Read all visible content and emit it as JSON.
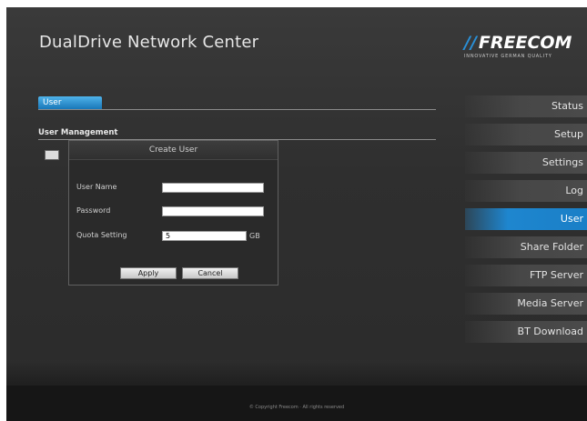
{
  "header": {
    "app_title": "DualDrive Network Center",
    "brand_name": "FREECOM",
    "brand_slashes": "//",
    "brand_tagline": "INNOVATIVE GERMAN QUALITY"
  },
  "main": {
    "active_tab": "User",
    "section_title": "User Management"
  },
  "dialog": {
    "title": "Create User",
    "fields": {
      "user_name_label": "User Name",
      "user_name_value": "",
      "password_label": "Password",
      "password_value": "",
      "quota_label": "Quota Setting",
      "quota_value": "5",
      "quota_unit": "GB"
    },
    "apply_label": "Apply",
    "cancel_label": "Cancel"
  },
  "sidebar": {
    "active": "User",
    "items": [
      {
        "label": "Status"
      },
      {
        "label": "Setup"
      },
      {
        "label": "Settings"
      },
      {
        "label": "Log"
      },
      {
        "label": "User"
      },
      {
        "label": "Share Folder"
      },
      {
        "label": "FTP Server"
      },
      {
        "label": "Media Server"
      },
      {
        "label": "BT Download"
      }
    ]
  },
  "footer": {
    "copyright": "© Copyright Freecom · All rights reserved"
  },
  "colors": {
    "accent": "#1e86cf",
    "background": "#2f2f2f"
  }
}
